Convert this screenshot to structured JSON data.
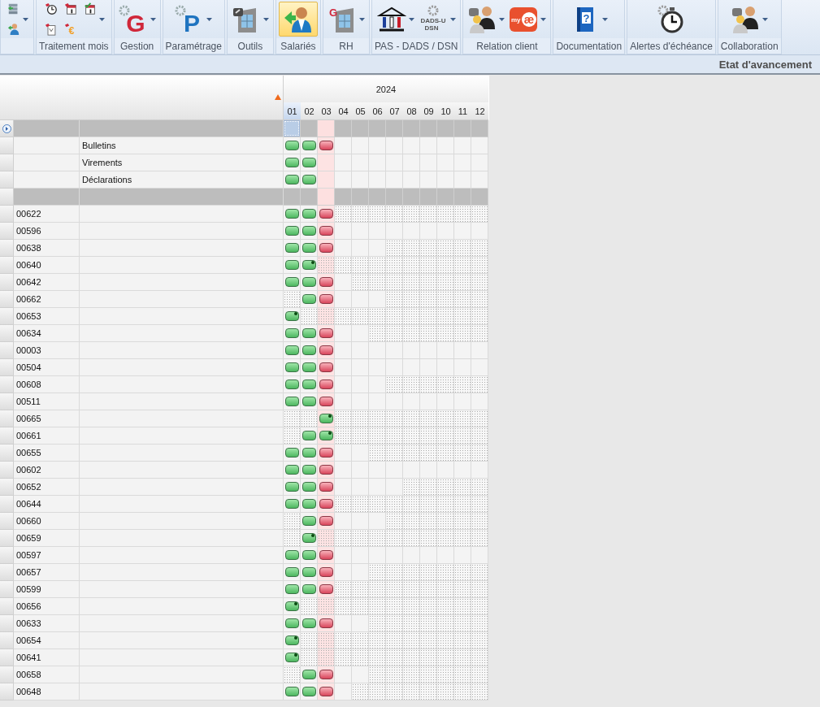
{
  "toolbar": {
    "groups": [
      {
        "selected": false,
        "kind": "compact",
        "dropdown": true,
        "icons": [
          {
            "kind": "server"
          },
          {
            "kind": "person"
          }
        ]
      },
      {
        "label": "Traitement mois",
        "selected": false,
        "kind": "compact",
        "dropdown": true,
        "icons": [
          {
            "kind": "clock"
          },
          {
            "kind": "calendar"
          },
          {
            "kind": "calendar-check"
          },
          {
            "kind": "document"
          },
          {
            "kind": "euro",
            "glyphs": [
              "€"
            ]
          }
        ]
      },
      {
        "label": "Gestion",
        "selected": false,
        "kind": "large",
        "icons": [
          {
            "kind": "letter",
            "color": "#d0273a",
            "glyphs": [
              "G"
            ],
            "dropdown": true
          }
        ]
      },
      {
        "label": "Paramétrage",
        "selected": false,
        "kind": "large",
        "icons": [
          {
            "kind": "letter",
            "color": "#1f74c0",
            "glyphs": [
              "P"
            ],
            "dropdown": true
          }
        ]
      },
      {
        "label": "Outils",
        "selected": false,
        "kind": "large",
        "icons": [
          {
            "kind": "building-tools",
            "dropdown": true
          }
        ]
      },
      {
        "label": "Salariés",
        "selected": true,
        "kind": "large",
        "icons": [
          {
            "kind": "person-arrow",
            "dropdown": false
          }
        ]
      },
      {
        "label": "RH",
        "selected": false,
        "kind": "large",
        "icons": [
          {
            "kind": "building-letter",
            "glyphs": [
              "G"
            ],
            "dropdown": true
          }
        ]
      },
      {
        "label": "PAS - DADS / DSN",
        "selected": false,
        "kind": "large",
        "icons": [
          {
            "kind": "bank",
            "dropdown": true
          },
          {
            "kind": "dads",
            "glyphs": [
              "DADS-U",
              "DSN"
            ],
            "dropdown": true
          }
        ]
      },
      {
        "label": "Relation client",
        "selected": false,
        "kind": "large",
        "icons": [
          {
            "kind": "people",
            "dropdown": true
          },
          {
            "kind": "logo-badge",
            "glyphs": [
              "my",
              "æ"
            ],
            "dropdown": true
          }
        ]
      },
      {
        "label": "Documentation",
        "selected": false,
        "kind": "large",
        "icons": [
          {
            "kind": "book",
            "glyphs": [
              "?"
            ],
            "dropdown": true
          }
        ]
      },
      {
        "label": "Alertes d'échéance",
        "selected": false,
        "kind": "large",
        "icons": [
          {
            "kind": "stopwatch",
            "dropdown": false
          }
        ]
      },
      {
        "label": "Collaboration",
        "selected": false,
        "kind": "large",
        "icons": [
          {
            "kind": "people",
            "dropdown": true
          }
        ]
      }
    ]
  },
  "title": "Etat d'avancement",
  "grid": {
    "year": "2024",
    "group_expanded": false,
    "months": [
      {
        "label": "01",
        "selected": true,
        "current": false
      },
      {
        "label": "02",
        "selected": false,
        "current": false
      },
      {
        "label": "03",
        "selected": false,
        "current": true
      },
      {
        "label": "04",
        "selected": false,
        "current": false
      },
      {
        "label": "05",
        "selected": false,
        "current": false
      },
      {
        "label": "06",
        "selected": false,
        "current": false
      },
      {
        "label": "07",
        "selected": false,
        "current": false
      },
      {
        "label": "08",
        "selected": false,
        "current": false
      },
      {
        "label": "09",
        "selected": false,
        "current": false
      },
      {
        "label": "10",
        "selected": false,
        "current": false
      },
      {
        "label": "11",
        "selected": false,
        "current": false
      },
      {
        "label": "12",
        "selected": false,
        "current": false
      }
    ],
    "summary_rows": [
      {
        "label": "Bulletins",
        "cells": [
          {
            "kind": "done"
          },
          {
            "kind": "done"
          },
          {
            "kind": "todo"
          },
          {
            "kind": "open"
          },
          {
            "kind": "open"
          },
          {
            "kind": "open"
          },
          {
            "kind": "open"
          },
          {
            "kind": "open"
          },
          {
            "kind": "open"
          },
          {
            "kind": "open"
          },
          {
            "kind": "open"
          },
          {
            "kind": "open"
          }
        ]
      },
      {
        "label": "Virements",
        "cells": [
          {
            "kind": "done"
          },
          {
            "kind": "done"
          },
          {
            "kind": "open"
          },
          {
            "kind": "open"
          },
          {
            "kind": "open"
          },
          {
            "kind": "open"
          },
          {
            "kind": "open"
          },
          {
            "kind": "open"
          },
          {
            "kind": "open"
          },
          {
            "kind": "open"
          },
          {
            "kind": "open"
          },
          {
            "kind": "open"
          }
        ]
      },
      {
        "label": "Déclarations",
        "cells": [
          {
            "kind": "done"
          },
          {
            "kind": "done"
          },
          {
            "kind": "open"
          },
          {
            "kind": "open"
          },
          {
            "kind": "open"
          },
          {
            "kind": "open"
          },
          {
            "kind": "open"
          },
          {
            "kind": "open"
          },
          {
            "kind": "open"
          },
          {
            "kind": "open"
          },
          {
            "kind": "open"
          },
          {
            "kind": "open"
          }
        ]
      }
    ],
    "rows": [
      {
        "code": "00622",
        "cells": [
          {
            "kind": "done"
          },
          {
            "kind": "done"
          },
          {
            "kind": "todo"
          },
          {
            "kind": "closed"
          },
          {
            "kind": "closed"
          },
          {
            "kind": "closed"
          },
          {
            "kind": "closed"
          },
          {
            "kind": "closed"
          },
          {
            "kind": "closed"
          },
          {
            "kind": "closed"
          },
          {
            "kind": "closed"
          },
          {
            "kind": "closed"
          }
        ]
      },
      {
        "code": "00596",
        "cells": [
          {
            "kind": "done"
          },
          {
            "kind": "done"
          },
          {
            "kind": "todo"
          },
          {
            "kind": "open"
          },
          {
            "kind": "open"
          },
          {
            "kind": "open"
          },
          {
            "kind": "open"
          },
          {
            "kind": "open"
          },
          {
            "kind": "open"
          },
          {
            "kind": "open"
          },
          {
            "kind": "open"
          },
          {
            "kind": "open"
          }
        ]
      },
      {
        "code": "00638",
        "cells": [
          {
            "kind": "done"
          },
          {
            "kind": "done"
          },
          {
            "kind": "todo"
          },
          {
            "kind": "open"
          },
          {
            "kind": "open"
          },
          {
            "kind": "open"
          },
          {
            "kind": "closed"
          },
          {
            "kind": "closed"
          },
          {
            "kind": "closed"
          },
          {
            "kind": "closed"
          },
          {
            "kind": "closed"
          },
          {
            "kind": "closed"
          }
        ]
      },
      {
        "code": "00640",
        "cells": [
          {
            "kind": "done"
          },
          {
            "kind": "latest"
          },
          {
            "kind": "closed"
          },
          {
            "kind": "closed"
          },
          {
            "kind": "closed"
          },
          {
            "kind": "closed"
          },
          {
            "kind": "closed"
          },
          {
            "kind": "closed"
          },
          {
            "kind": "closed"
          },
          {
            "kind": "closed"
          },
          {
            "kind": "closed"
          },
          {
            "kind": "closed"
          }
        ]
      },
      {
        "code": "00642",
        "cells": [
          {
            "kind": "done"
          },
          {
            "kind": "done"
          },
          {
            "kind": "todo"
          },
          {
            "kind": "open"
          },
          {
            "kind": "closed"
          },
          {
            "kind": "closed"
          },
          {
            "kind": "closed"
          },
          {
            "kind": "closed"
          },
          {
            "kind": "closed"
          },
          {
            "kind": "closed"
          },
          {
            "kind": "closed"
          },
          {
            "kind": "closed"
          }
        ]
      },
      {
        "code": "00662",
        "cells": [
          {
            "kind": "closed"
          },
          {
            "kind": "done"
          },
          {
            "kind": "todo"
          },
          {
            "kind": "open"
          },
          {
            "kind": "open"
          },
          {
            "kind": "open"
          },
          {
            "kind": "closed"
          },
          {
            "kind": "closed"
          },
          {
            "kind": "closed"
          },
          {
            "kind": "closed"
          },
          {
            "kind": "closed"
          },
          {
            "kind": "closed"
          }
        ]
      },
      {
        "code": "00653",
        "cells": [
          {
            "kind": "latest"
          },
          {
            "kind": "closed"
          },
          {
            "kind": "closed"
          },
          {
            "kind": "closed"
          },
          {
            "kind": "closed"
          },
          {
            "kind": "closed"
          },
          {
            "kind": "closed"
          },
          {
            "kind": "closed"
          },
          {
            "kind": "closed"
          },
          {
            "kind": "closed"
          },
          {
            "kind": "closed"
          },
          {
            "kind": "closed"
          }
        ]
      },
      {
        "code": "00634",
        "cells": [
          {
            "kind": "done"
          },
          {
            "kind": "done"
          },
          {
            "kind": "todo"
          },
          {
            "kind": "open"
          },
          {
            "kind": "open"
          },
          {
            "kind": "closed"
          },
          {
            "kind": "closed"
          },
          {
            "kind": "closed"
          },
          {
            "kind": "closed"
          },
          {
            "kind": "closed"
          },
          {
            "kind": "closed"
          },
          {
            "kind": "closed"
          }
        ]
      },
      {
        "code": "00003",
        "cells": [
          {
            "kind": "done"
          },
          {
            "kind": "done"
          },
          {
            "kind": "todo"
          },
          {
            "kind": "open"
          },
          {
            "kind": "open"
          },
          {
            "kind": "open"
          },
          {
            "kind": "open"
          },
          {
            "kind": "open"
          },
          {
            "kind": "open"
          },
          {
            "kind": "open"
          },
          {
            "kind": "open"
          },
          {
            "kind": "open"
          }
        ]
      },
      {
        "code": "00504",
        "cells": [
          {
            "kind": "done"
          },
          {
            "kind": "done"
          },
          {
            "kind": "todo"
          },
          {
            "kind": "open"
          },
          {
            "kind": "open"
          },
          {
            "kind": "open"
          },
          {
            "kind": "open"
          },
          {
            "kind": "open"
          },
          {
            "kind": "open"
          },
          {
            "kind": "open"
          },
          {
            "kind": "open"
          },
          {
            "kind": "open"
          }
        ]
      },
      {
        "code": "00608",
        "cells": [
          {
            "kind": "done"
          },
          {
            "kind": "done"
          },
          {
            "kind": "todo"
          },
          {
            "kind": "open"
          },
          {
            "kind": "open"
          },
          {
            "kind": "open"
          },
          {
            "kind": "closed"
          },
          {
            "kind": "closed"
          },
          {
            "kind": "closed"
          },
          {
            "kind": "closed"
          },
          {
            "kind": "closed"
          },
          {
            "kind": "closed"
          }
        ]
      },
      {
        "code": "00511",
        "cells": [
          {
            "kind": "done"
          },
          {
            "kind": "done"
          },
          {
            "kind": "todo"
          },
          {
            "kind": "open"
          },
          {
            "kind": "open"
          },
          {
            "kind": "open"
          },
          {
            "kind": "open"
          },
          {
            "kind": "open"
          },
          {
            "kind": "open"
          },
          {
            "kind": "open"
          },
          {
            "kind": "open"
          },
          {
            "kind": "open"
          }
        ]
      },
      {
        "code": "00665",
        "cells": [
          {
            "kind": "closed"
          },
          {
            "kind": "closed"
          },
          {
            "kind": "latest"
          },
          {
            "kind": "closed"
          },
          {
            "kind": "closed"
          },
          {
            "kind": "closed"
          },
          {
            "kind": "closed"
          },
          {
            "kind": "closed"
          },
          {
            "kind": "closed"
          },
          {
            "kind": "closed"
          },
          {
            "kind": "closed"
          },
          {
            "kind": "closed"
          }
        ]
      },
      {
        "code": "00661",
        "cells": [
          {
            "kind": "closed"
          },
          {
            "kind": "done"
          },
          {
            "kind": "latest"
          },
          {
            "kind": "closed"
          },
          {
            "kind": "closed"
          },
          {
            "kind": "closed"
          },
          {
            "kind": "closed"
          },
          {
            "kind": "closed"
          },
          {
            "kind": "closed"
          },
          {
            "kind": "closed"
          },
          {
            "kind": "closed"
          },
          {
            "kind": "closed"
          }
        ]
      },
      {
        "code": "00655",
        "cells": [
          {
            "kind": "done"
          },
          {
            "kind": "done"
          },
          {
            "kind": "todo"
          },
          {
            "kind": "open"
          },
          {
            "kind": "open"
          },
          {
            "kind": "closed"
          },
          {
            "kind": "closed"
          },
          {
            "kind": "closed"
          },
          {
            "kind": "closed"
          },
          {
            "kind": "closed"
          },
          {
            "kind": "closed"
          },
          {
            "kind": "closed"
          }
        ]
      },
      {
        "code": "00602",
        "cells": [
          {
            "kind": "done"
          },
          {
            "kind": "done"
          },
          {
            "kind": "todo"
          },
          {
            "kind": "open"
          },
          {
            "kind": "open"
          },
          {
            "kind": "open"
          },
          {
            "kind": "open"
          },
          {
            "kind": "open"
          },
          {
            "kind": "open"
          },
          {
            "kind": "open"
          },
          {
            "kind": "open"
          },
          {
            "kind": "open"
          }
        ]
      },
      {
        "code": "00652",
        "cells": [
          {
            "kind": "done"
          },
          {
            "kind": "done"
          },
          {
            "kind": "todo"
          },
          {
            "kind": "open"
          },
          {
            "kind": "open"
          },
          {
            "kind": "open"
          },
          {
            "kind": "open"
          },
          {
            "kind": "closed"
          },
          {
            "kind": "closed"
          },
          {
            "kind": "closed"
          },
          {
            "kind": "closed"
          },
          {
            "kind": "closed"
          }
        ]
      },
      {
        "code": "00644",
        "cells": [
          {
            "kind": "done"
          },
          {
            "kind": "done"
          },
          {
            "kind": "todo"
          },
          {
            "kind": "closed"
          },
          {
            "kind": "closed"
          },
          {
            "kind": "closed"
          },
          {
            "kind": "closed"
          },
          {
            "kind": "closed"
          },
          {
            "kind": "closed"
          },
          {
            "kind": "closed"
          },
          {
            "kind": "closed"
          },
          {
            "kind": "closed"
          }
        ]
      },
      {
        "code": "00660",
        "cells": [
          {
            "kind": "closed"
          },
          {
            "kind": "done"
          },
          {
            "kind": "todo"
          },
          {
            "kind": "open"
          },
          {
            "kind": "open"
          },
          {
            "kind": "open"
          },
          {
            "kind": "closed"
          },
          {
            "kind": "closed"
          },
          {
            "kind": "closed"
          },
          {
            "kind": "closed"
          },
          {
            "kind": "closed"
          },
          {
            "kind": "closed"
          }
        ]
      },
      {
        "code": "00659",
        "cells": [
          {
            "kind": "closed"
          },
          {
            "kind": "latest"
          },
          {
            "kind": "closed"
          },
          {
            "kind": "closed"
          },
          {
            "kind": "closed"
          },
          {
            "kind": "closed"
          },
          {
            "kind": "closed"
          },
          {
            "kind": "closed"
          },
          {
            "kind": "closed"
          },
          {
            "kind": "closed"
          },
          {
            "kind": "closed"
          },
          {
            "kind": "closed"
          }
        ]
      },
      {
        "code": "00597",
        "cells": [
          {
            "kind": "done"
          },
          {
            "kind": "done"
          },
          {
            "kind": "todo"
          },
          {
            "kind": "open"
          },
          {
            "kind": "open"
          },
          {
            "kind": "open"
          },
          {
            "kind": "open"
          },
          {
            "kind": "open"
          },
          {
            "kind": "open"
          },
          {
            "kind": "open"
          },
          {
            "kind": "open"
          },
          {
            "kind": "open"
          }
        ]
      },
      {
        "code": "00657",
        "cells": [
          {
            "kind": "done"
          },
          {
            "kind": "done"
          },
          {
            "kind": "todo"
          },
          {
            "kind": "open"
          },
          {
            "kind": "open"
          },
          {
            "kind": "closed"
          },
          {
            "kind": "closed"
          },
          {
            "kind": "closed"
          },
          {
            "kind": "closed"
          },
          {
            "kind": "closed"
          },
          {
            "kind": "closed"
          },
          {
            "kind": "closed"
          }
        ]
      },
      {
        "code": "00599",
        "cells": [
          {
            "kind": "done"
          },
          {
            "kind": "done"
          },
          {
            "kind": "todo"
          },
          {
            "kind": "closed"
          },
          {
            "kind": "closed"
          },
          {
            "kind": "closed"
          },
          {
            "kind": "closed"
          },
          {
            "kind": "closed"
          },
          {
            "kind": "closed"
          },
          {
            "kind": "closed"
          },
          {
            "kind": "closed"
          },
          {
            "kind": "closed"
          }
        ]
      },
      {
        "code": "00656",
        "cells": [
          {
            "kind": "latest"
          },
          {
            "kind": "closed"
          },
          {
            "kind": "closed"
          },
          {
            "kind": "closed"
          },
          {
            "kind": "closed"
          },
          {
            "kind": "closed"
          },
          {
            "kind": "closed"
          },
          {
            "kind": "closed"
          },
          {
            "kind": "closed"
          },
          {
            "kind": "closed"
          },
          {
            "kind": "closed"
          },
          {
            "kind": "closed"
          }
        ]
      },
      {
        "code": "00633",
        "cells": [
          {
            "kind": "done"
          },
          {
            "kind": "done"
          },
          {
            "kind": "todo"
          },
          {
            "kind": "open"
          },
          {
            "kind": "open"
          },
          {
            "kind": "closed"
          },
          {
            "kind": "closed"
          },
          {
            "kind": "closed"
          },
          {
            "kind": "closed"
          },
          {
            "kind": "closed"
          },
          {
            "kind": "closed"
          },
          {
            "kind": "closed"
          }
        ]
      },
      {
        "code": "00654",
        "cells": [
          {
            "kind": "latest"
          },
          {
            "kind": "closed"
          },
          {
            "kind": "closed"
          },
          {
            "kind": "closed"
          },
          {
            "kind": "closed"
          },
          {
            "kind": "closed"
          },
          {
            "kind": "closed"
          },
          {
            "kind": "closed"
          },
          {
            "kind": "closed"
          },
          {
            "kind": "closed"
          },
          {
            "kind": "closed"
          },
          {
            "kind": "closed"
          }
        ]
      },
      {
        "code": "00641",
        "cells": [
          {
            "kind": "latest"
          },
          {
            "kind": "closed"
          },
          {
            "kind": "closed"
          },
          {
            "kind": "closed"
          },
          {
            "kind": "closed"
          },
          {
            "kind": "closed"
          },
          {
            "kind": "closed"
          },
          {
            "kind": "closed"
          },
          {
            "kind": "closed"
          },
          {
            "kind": "closed"
          },
          {
            "kind": "closed"
          },
          {
            "kind": "closed"
          }
        ]
      },
      {
        "code": "00658",
        "cells": [
          {
            "kind": "closed"
          },
          {
            "kind": "done"
          },
          {
            "kind": "todo"
          },
          {
            "kind": "open"
          },
          {
            "kind": "open"
          },
          {
            "kind": "closed"
          },
          {
            "kind": "closed"
          },
          {
            "kind": "closed"
          },
          {
            "kind": "closed"
          },
          {
            "kind": "closed"
          },
          {
            "kind": "closed"
          },
          {
            "kind": "closed"
          }
        ]
      },
      {
        "code": "00648",
        "cells": [
          {
            "kind": "done"
          },
          {
            "kind": "done"
          },
          {
            "kind": "todo"
          },
          {
            "kind": "open"
          },
          {
            "kind": "closed"
          },
          {
            "kind": "closed"
          },
          {
            "kind": "closed"
          },
          {
            "kind": "closed"
          },
          {
            "kind": "closed"
          },
          {
            "kind": "closed"
          },
          {
            "kind": "closed"
          },
          {
            "kind": "closed"
          }
        ]
      }
    ]
  }
}
